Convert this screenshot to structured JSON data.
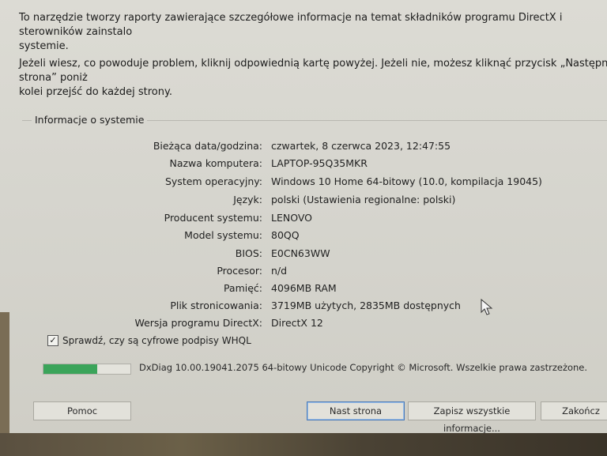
{
  "intro": {
    "line1": "To narzędzie tworzy raporty zawierające szczegółowe informacje na temat składników programu DirectX i sterowników zainstalo\nsystemie.",
    "line2": "Jeżeli wiesz, co powoduje problem, kliknij odpowiednią kartę powyżej. Jeżeli nie, możesz kliknąć przycisk „Następna strona” poniż\nkolei przejść do każdej strony."
  },
  "system_info": {
    "title": "Informacje o systemie",
    "rows": [
      {
        "label": "Bieżąca data/godzina:",
        "value": "czwartek, 8 czerwca 2023, 12:47:55"
      },
      {
        "label": "Nazwa komputera:",
        "value": "LAPTOP-95Q35MKR"
      },
      {
        "label": "System operacyjny:",
        "value": "Windows 10 Home 64-bitowy (10.0, kompilacja 19045)"
      },
      {
        "label": "Język:",
        "value": "polski (Ustawienia regionalne: polski)"
      },
      {
        "label": "Producent systemu:",
        "value": "LENOVO"
      },
      {
        "label": "Model systemu:",
        "value": "80QQ"
      },
      {
        "label": "BIOS:",
        "value": "E0CN63WW"
      },
      {
        "label": "Procesor:",
        "value": "n/d"
      },
      {
        "label": "Pamięć:",
        "value": "4096MB RAM"
      },
      {
        "label": "Plik stronicowania:",
        "value": "3719MB użytych, 2835MB dostępnych"
      },
      {
        "label": "Wersja programu DirectX:",
        "value": "DirectX 12"
      }
    ]
  },
  "whql_check": {
    "label": "Sprawdź, czy są cyfrowe podpisy WHQL",
    "checked": true,
    "mark": "✓"
  },
  "progress": {
    "fraction": 0.62,
    "color": "#3ba45a"
  },
  "copyright": "DxDiag 10.00.19041.2075 64-bitowy Unicode  Copyright © Microsoft. Wszelkie prawa zastrzeżone.",
  "buttons": {
    "help": "Pomoc",
    "next": "Nast  strona",
    "save": "Zapisz wszystkie informacje...",
    "close": "Zakończ"
  }
}
